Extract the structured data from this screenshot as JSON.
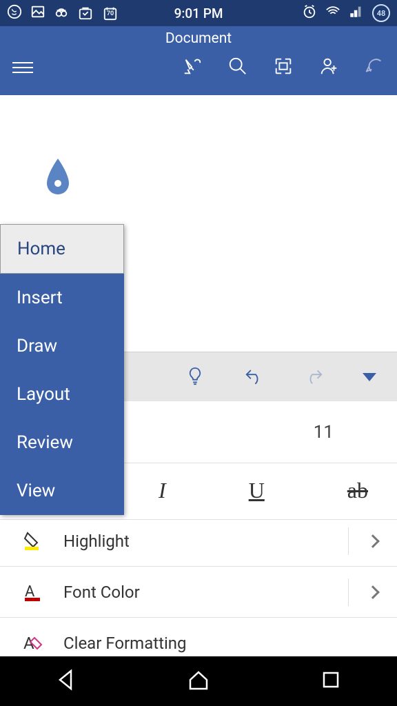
{
  "status": {
    "time": "9:01 PM",
    "calendar_badge": "70",
    "battery_pct": "48"
  },
  "appbar": {
    "title": "Document"
  },
  "menu": {
    "items": [
      {
        "label": "Home",
        "selected": true
      },
      {
        "label": "Insert",
        "selected": false
      },
      {
        "label": "Draw",
        "selected": false
      },
      {
        "label": "Layout",
        "selected": false
      },
      {
        "label": "Review",
        "selected": false
      },
      {
        "label": "View",
        "selected": false
      }
    ]
  },
  "format": {
    "font_size": "11",
    "styles": {
      "italic": "I",
      "underline": "U",
      "strike": "ab"
    },
    "rows": {
      "highlight": "Highlight",
      "font_color": "Font Color",
      "clear": "Clear Formatting"
    }
  }
}
